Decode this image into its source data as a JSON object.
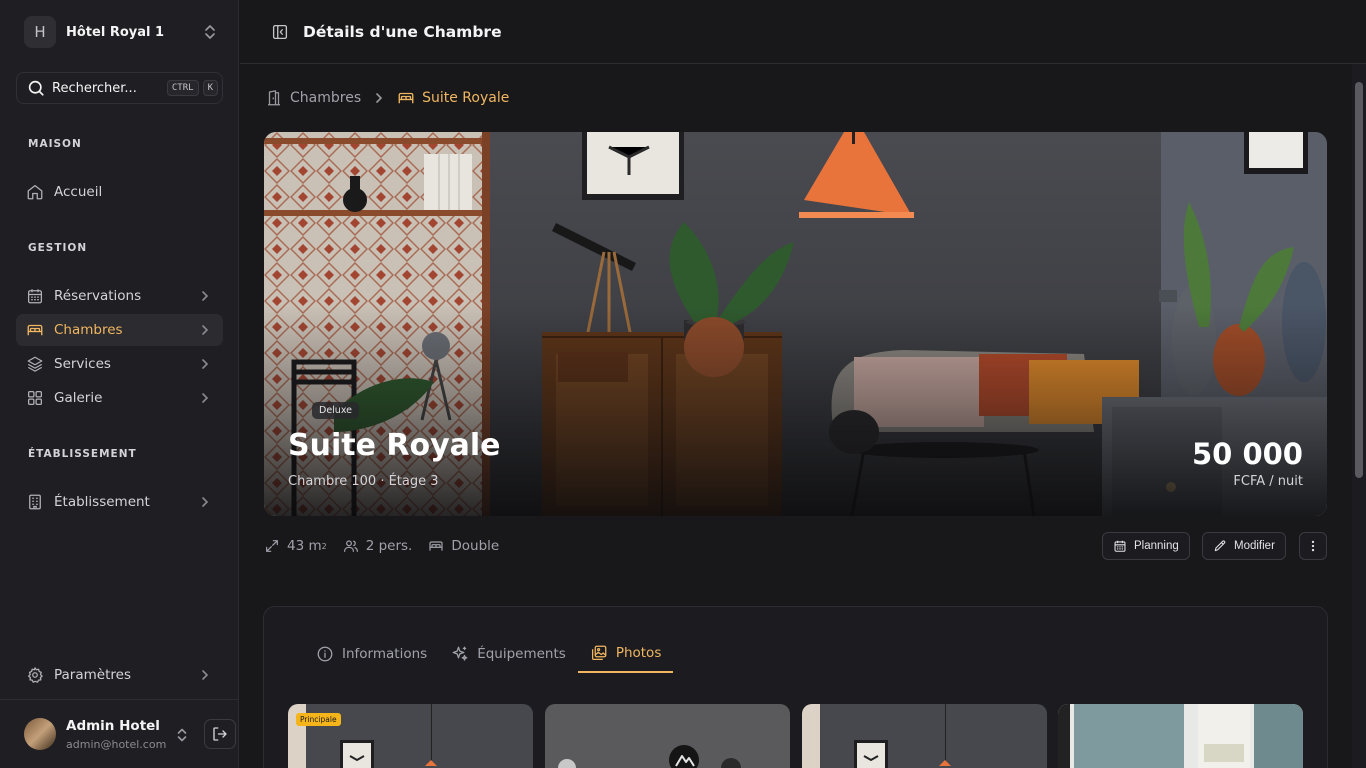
{
  "sidebar": {
    "hotel_initial": "H",
    "hotel_name": "Hôtel Royal 1",
    "search_label": "Rechercher...",
    "kbd_ctrl": "CTRL",
    "kbd_k": "K",
    "sections": {
      "maison": "MAISON",
      "gestion": "GESTION",
      "etablissement": "ÉTABLISSEMENT"
    },
    "items": {
      "accueil": "Accueil",
      "reservations": "Réservations",
      "chambres": "Chambres",
      "services": "Services",
      "galerie": "Galerie",
      "etablissement": "Établissement",
      "parametres": "Paramètres"
    },
    "active_item": "Chambres",
    "accent_color": "#f0b660"
  },
  "user": {
    "name": "Admin Hotel",
    "email": "admin@hotel.com"
  },
  "header": {
    "title": "Détails d'une Chambre"
  },
  "breadcrumb": {
    "parent": "Chambres",
    "current": "Suite Royale"
  },
  "room": {
    "badge": "Deluxe",
    "name": "Suite Royale",
    "subtitle": "Chambre 100 · Étage 3",
    "price": "50 000",
    "price_unit": "FCFA / nuit",
    "area_value": "43 m",
    "area_sup": "2",
    "capacity": "2 pers.",
    "bed": "Double"
  },
  "actions": {
    "planning": "Planning",
    "modifier": "Modifier"
  },
  "tabs": {
    "informations": "Informations",
    "equipements": "Équipements",
    "photos": "Photos",
    "active": "Photos"
  },
  "photos": {
    "main_badge": "Principale"
  },
  "icons": {
    "hotel_switch": "chevrons-up-down-icon",
    "search": "search-icon",
    "home": "home-icon",
    "calendar": "calendar-icon",
    "bed": "bed-icon",
    "layers": "layers-icon",
    "grid": "grid-icon",
    "building": "building-icon",
    "settings": "gear-icon",
    "logout": "logout-icon",
    "panel": "panel-toggle-icon",
    "door": "door-icon",
    "expand": "expand-icon",
    "users": "users-icon",
    "pencil": "pencil-icon",
    "more": "more-vertical-icon",
    "info": "info-icon",
    "sparkles": "sparkles-icon",
    "images": "images-icon"
  }
}
